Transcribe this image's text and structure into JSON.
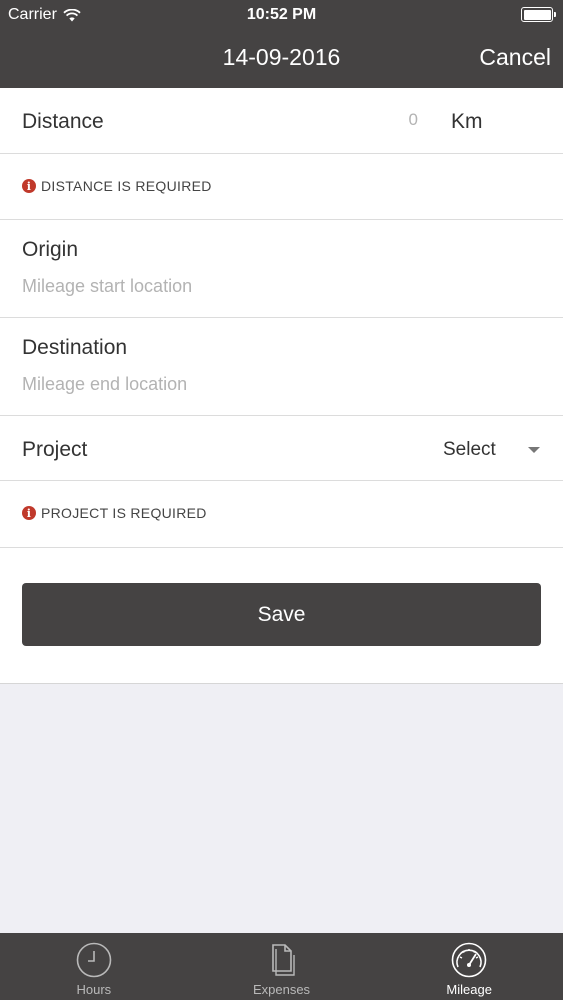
{
  "status": {
    "carrier": "Carrier",
    "time": "10:52 PM"
  },
  "nav": {
    "title": "14-09-2016",
    "cancel_label": "Cancel"
  },
  "form": {
    "distance": {
      "label": "Distance",
      "value": "0",
      "unit": "Km",
      "error": "DISTANCE IS REQUIRED"
    },
    "origin": {
      "label": "Origin",
      "placeholder": "Mileage start location"
    },
    "destination": {
      "label": "Destination",
      "placeholder": "Mileage end location"
    },
    "project": {
      "label": "Project",
      "selected": "Select",
      "error": "PROJECT IS REQUIRED"
    },
    "save_label": "Save"
  },
  "tabs": [
    {
      "label": "Hours",
      "icon": "clock-icon",
      "active": false
    },
    {
      "label": "Expenses",
      "icon": "document-icon",
      "active": false
    },
    {
      "label": "Mileage",
      "icon": "speedometer-icon",
      "active": true
    }
  ],
  "colors": {
    "bar": "#454343",
    "error": "#c0392b",
    "placeholder": "#b3b3b3"
  }
}
